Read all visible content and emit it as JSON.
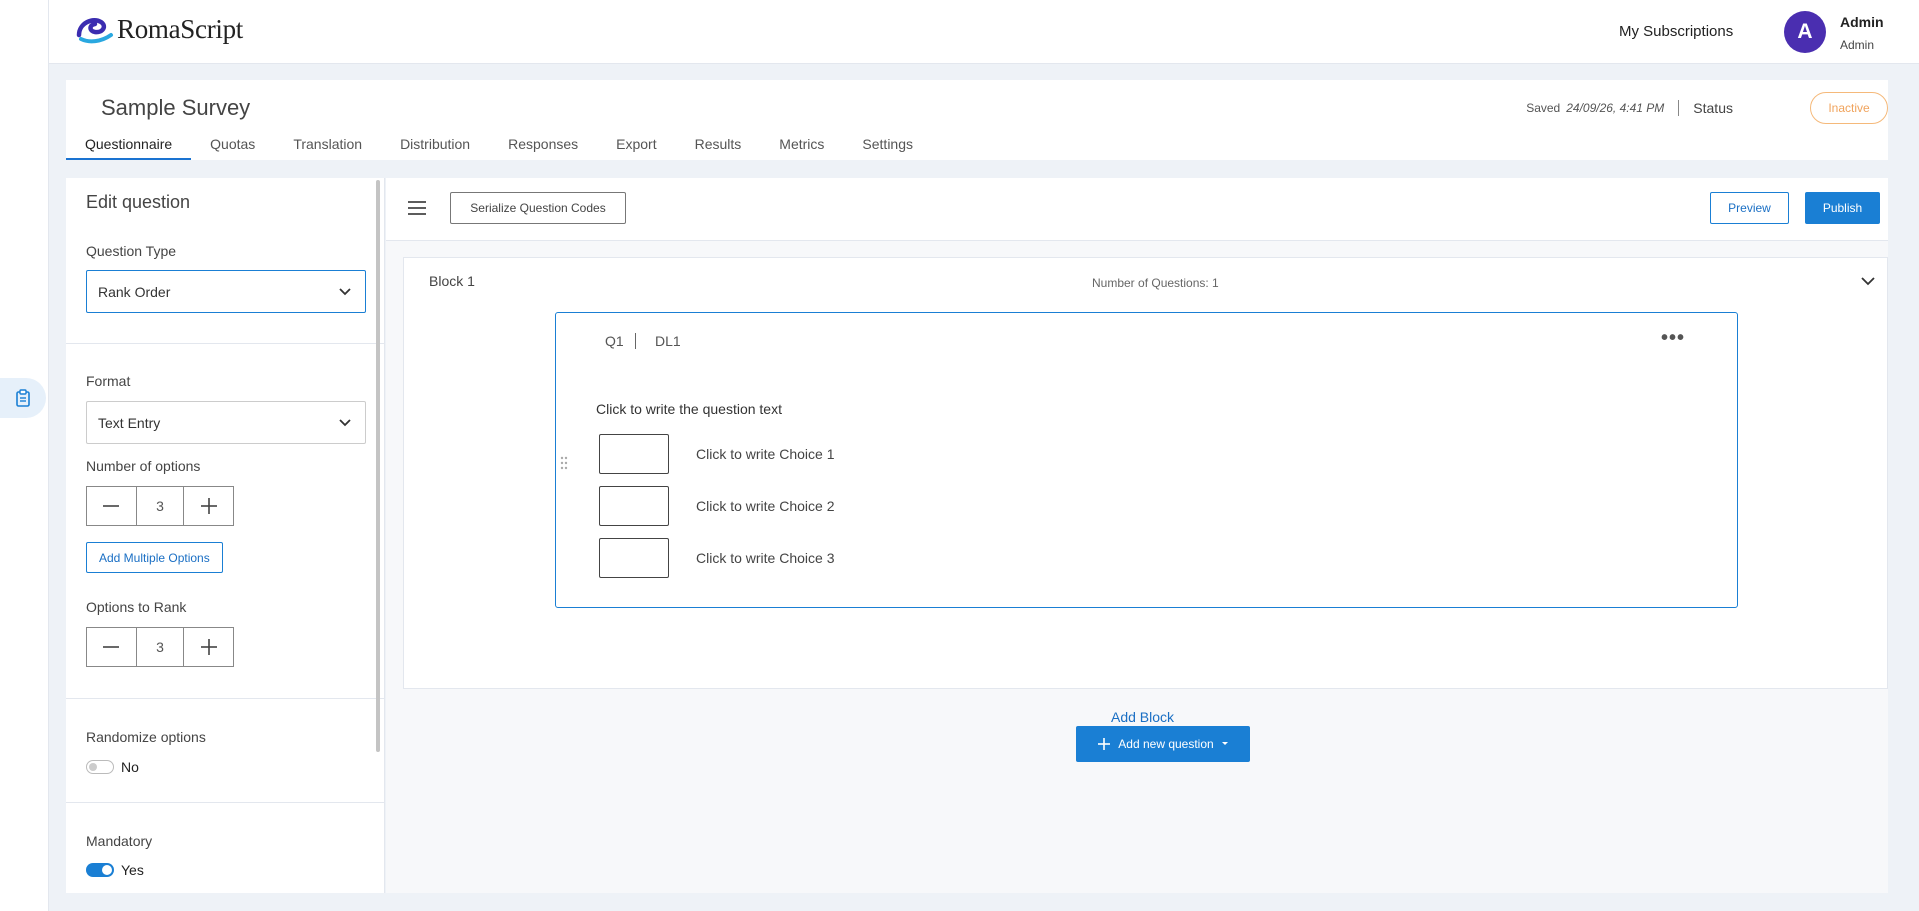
{
  "app": {
    "brand": "RomaScript"
  },
  "header": {
    "subscriptions_label": "My Subscriptions",
    "avatar_initial": "A",
    "user_name": "Admin",
    "user_role": "Admin"
  },
  "survey": {
    "title": "Sample Survey",
    "saved_label": "Saved",
    "saved_at": "24/09/26, 4:41 PM",
    "status_label": "Status",
    "status_value": "Inactive",
    "tabs": [
      {
        "label": "Questionnaire",
        "active": true
      },
      {
        "label": "Quotas"
      },
      {
        "label": "Translation"
      },
      {
        "label": "Distribution"
      },
      {
        "label": "Responses"
      },
      {
        "label": "Export"
      },
      {
        "label": "Results"
      },
      {
        "label": "Metrics"
      },
      {
        "label": "Settings"
      }
    ]
  },
  "edit_panel": {
    "title": "Edit question",
    "question_type_label": "Question Type",
    "question_type_value": "Rank Order",
    "format_label": "Format",
    "format_value": "Text Entry",
    "num_options_label": "Number of options",
    "num_options_value": "3",
    "add_multiple_label": "Add Multiple Options",
    "options_to_rank_label": "Options to Rank",
    "options_to_rank_value": "3",
    "randomize_label": "Randomize options",
    "randomize_value": "No",
    "mandatory_label": "Mandatory",
    "mandatory_value": "Yes"
  },
  "toolbar": {
    "serialize_label": "Serialize Question Codes",
    "preview_label": "Preview",
    "publish_label": "Publish"
  },
  "block": {
    "title": "Block 1",
    "count_text": "Number of Questions: 1",
    "question": {
      "id": "Q1",
      "code": "DL1",
      "text": "Click to write the question text",
      "choices": [
        "Click to write Choice 1",
        "Click to write Choice 2",
        "Click to write Choice 3"
      ]
    }
  },
  "actions": {
    "add_question_label": "Add new question",
    "add_block_label": "Add Block"
  },
  "colors": {
    "primary": "#1a7fd4",
    "avatar": "#4a2eb0",
    "inactive": "#f0a35c"
  }
}
